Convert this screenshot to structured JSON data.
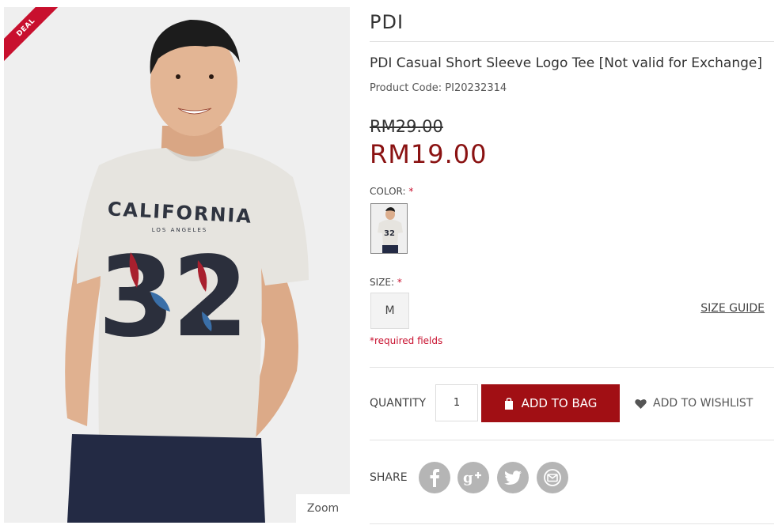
{
  "gallery": {
    "deal_badge": "DEAL",
    "zoom_label": "Zoom",
    "shirt_print_line1": "CALIFORNIA",
    "shirt_print_line2": "LOS ANGELES",
    "shirt_print_number": "32"
  },
  "product": {
    "brand": "PDI",
    "name": "PDI Casual Short Sleeve Logo Tee [Not valid for Exchange]",
    "code_label": "Product Code: PI20232314",
    "original_price": "RM29.00",
    "sale_price": "RM19.00"
  },
  "options": {
    "color_label": "COLOR:",
    "required_mark": "*",
    "size_label": "SIZE:",
    "sizes": [
      "M"
    ],
    "size_guide": "SIZE GUIDE",
    "required_note": "*required fields"
  },
  "purchase": {
    "quantity_label": "QUANTITY",
    "quantity_value": "1",
    "add_to_bag": "ADD TO BAG",
    "add_to_wishlist": "ADD TO WISHLIST"
  },
  "share": {
    "label": "SHARE",
    "icons": [
      "facebook-icon",
      "google-plus-icon",
      "twitter-icon",
      "email-icon"
    ]
  },
  "colors": {
    "accent": "#a10f14",
    "sale_price": "#8a1212",
    "required": "#c8102e",
    "social_icon_bg": "#b5b5b5"
  }
}
